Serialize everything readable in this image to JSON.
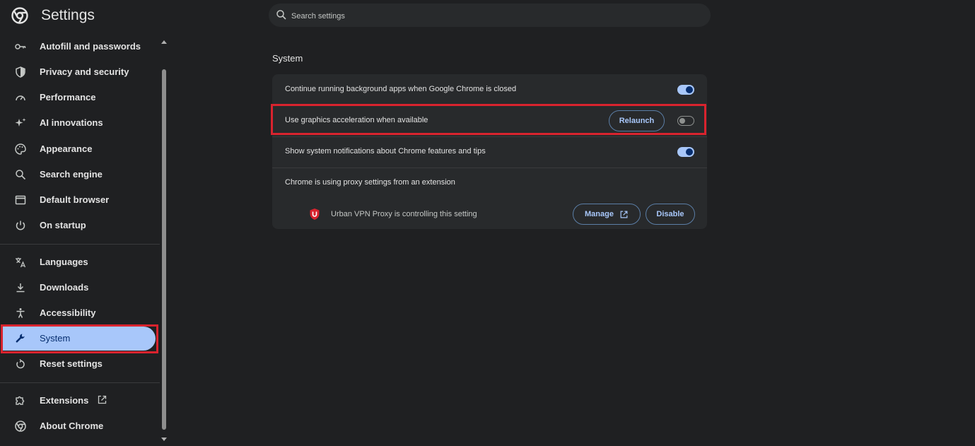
{
  "app": {
    "title": "Settings"
  },
  "search": {
    "placeholder": "Search settings"
  },
  "sidebar": {
    "items": [
      {
        "label": "Autofill and passwords"
      },
      {
        "label": "Privacy and security"
      },
      {
        "label": "Performance"
      },
      {
        "label": "AI innovations"
      },
      {
        "label": "Appearance"
      },
      {
        "label": "Search engine"
      },
      {
        "label": "Default browser"
      },
      {
        "label": "On startup"
      },
      {
        "label": "Languages"
      },
      {
        "label": "Downloads"
      },
      {
        "label": "Accessibility"
      },
      {
        "label": "System",
        "active": true
      },
      {
        "label": "Reset settings"
      },
      {
        "label": "Extensions"
      },
      {
        "label": "About Chrome"
      }
    ]
  },
  "section": {
    "title": "System"
  },
  "settings": {
    "background_apps": {
      "label": "Continue running background apps when Google Chrome is closed",
      "enabled": true
    },
    "graphics_accel": {
      "label": "Use graphics acceleration when available",
      "enabled": false,
      "relaunch_label": "Relaunch"
    },
    "notifications": {
      "label": "Show system notifications about Chrome features and tips",
      "enabled": true
    },
    "proxy": {
      "label": "Chrome is using proxy settings from an extension",
      "extension_text": "Urban VPN Proxy is controlling this setting",
      "manage_label": "Manage",
      "disable_label": "Disable"
    }
  },
  "colors": {
    "background": "#1f2022",
    "card": "#282a2c",
    "accent": "#a8c7fa",
    "highlight_border": "#d9232e"
  }
}
